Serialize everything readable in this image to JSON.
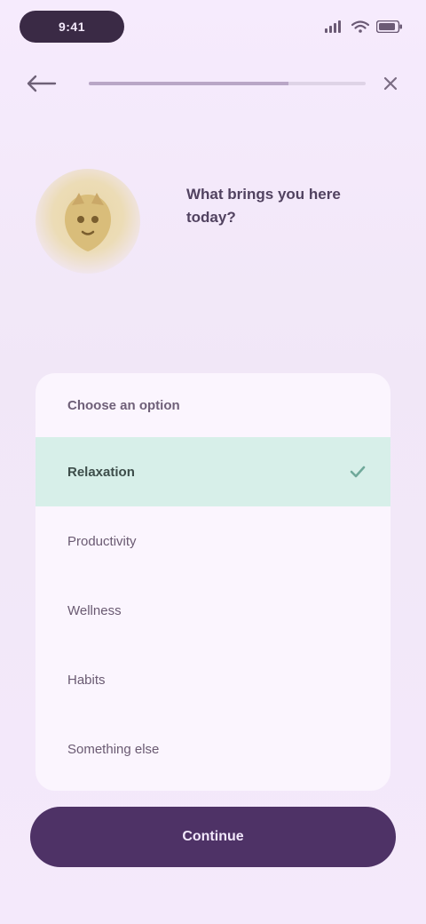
{
  "status_bar": {
    "time": "9:41"
  },
  "header": {
    "progress": 0.72
  },
  "hero": {
    "prompt": "What brings you here today?"
  },
  "options_card": {
    "title": "Choose an option",
    "items": [
      {
        "label": "Relaxation",
        "selected": true
      },
      {
        "label": "Productivity",
        "selected": false
      },
      {
        "label": "Wellness",
        "selected": false
      },
      {
        "label": "Habits",
        "selected": false
      },
      {
        "label": "Something else",
        "selected": false
      }
    ]
  },
  "continue_button": {
    "label": "Continue"
  },
  "colors": {
    "accent": "#4e3266",
    "selected_bg": "#d7efe9",
    "background": "#f3e8fb"
  }
}
